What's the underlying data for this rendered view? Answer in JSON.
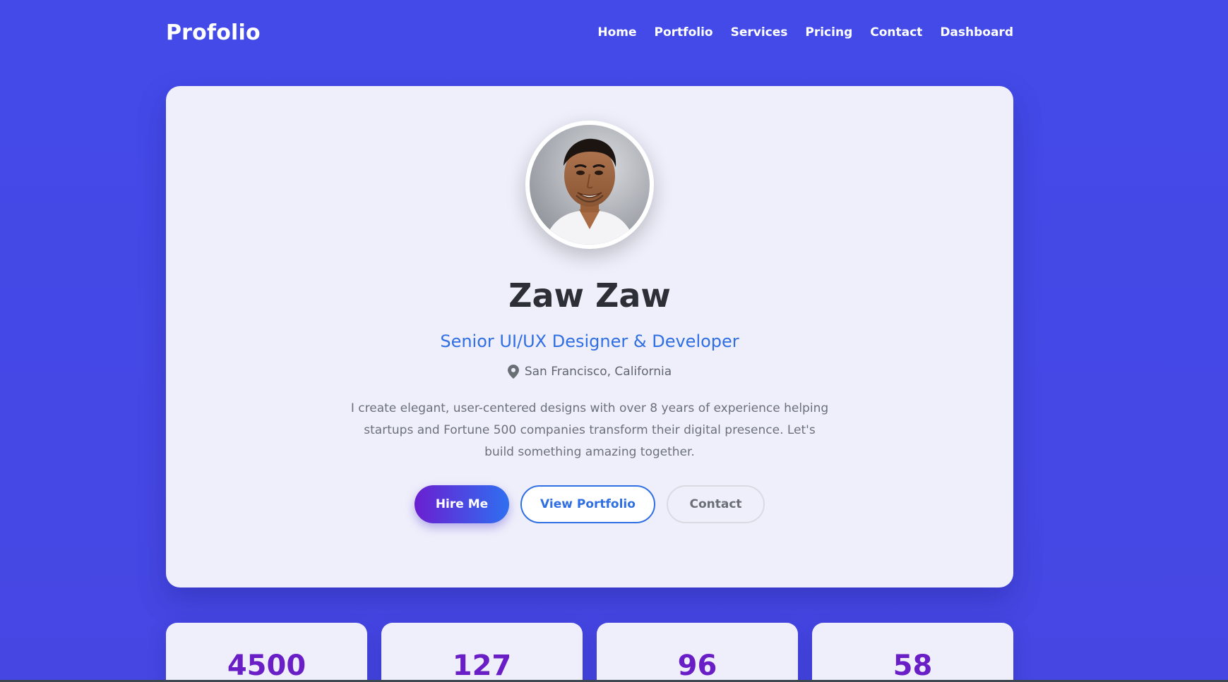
{
  "brand": {
    "name": "Profolio"
  },
  "nav": {
    "items": [
      {
        "label": "Home"
      },
      {
        "label": "Portfolio"
      },
      {
        "label": "Services"
      },
      {
        "label": "Pricing"
      },
      {
        "label": "Contact"
      },
      {
        "label": "Dashboard"
      }
    ]
  },
  "hero": {
    "name": "Zaw Zaw",
    "title": "Senior UI/UX Designer & Developer",
    "location": "San Francisco, California",
    "bio": "I create elegant, user-centered designs with over 8 years of experience helping startups and Fortune 500 companies transform their digital presence. Let's build something amazing together.",
    "buttons": {
      "hire": "Hire Me",
      "portfolio": "View Portfolio",
      "contact": "Contact"
    }
  },
  "stats": [
    {
      "value": "4500"
    },
    {
      "value": "127"
    },
    {
      "value": "96"
    },
    {
      "value": "58"
    }
  ],
  "colors": {
    "background": "#4349e6",
    "card": "#efeffb",
    "accent_blue": "#2f6fe3",
    "accent_purple": "#6a1fc6"
  },
  "icons": {
    "location": "map-pin-icon",
    "avatar": "profile-photo"
  }
}
